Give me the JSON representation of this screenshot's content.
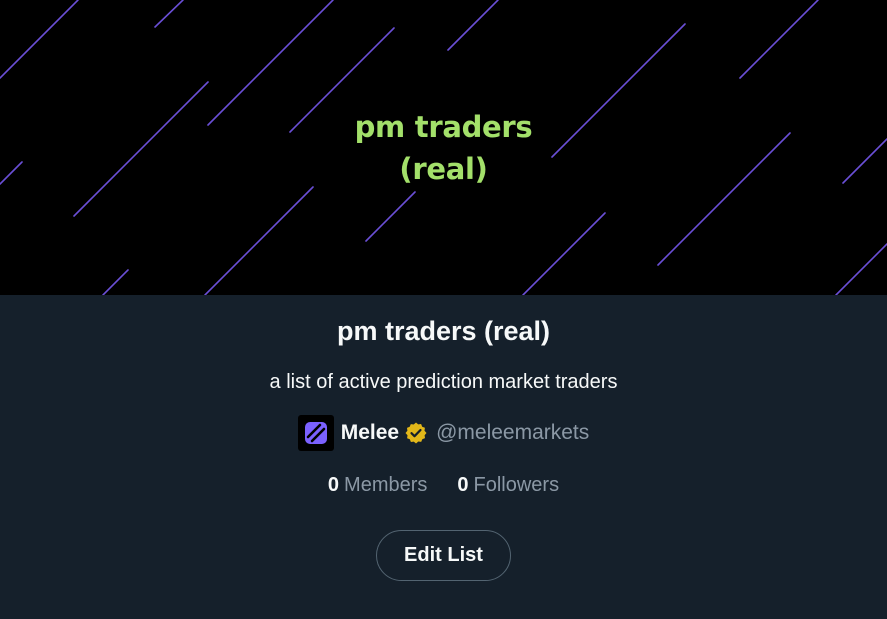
{
  "banner": {
    "title_line1": "pm traders",
    "title_line2": "(real)"
  },
  "list": {
    "name": "pm traders (real)",
    "description": "a list of active prediction market traders"
  },
  "owner": {
    "name": "Melee",
    "handle": "@meleemarkets",
    "avatar_icon": "melee-logo-icon",
    "badge_icon": "verified-badge-icon"
  },
  "stats": {
    "members_count": "0",
    "members_label": "Members",
    "followers_count": "0",
    "followers_label": "Followers"
  },
  "actions": {
    "edit_label": "Edit List"
  },
  "colors": {
    "background": "#15202b",
    "banner_bg": "#000000",
    "banner_text": "#a3e06a",
    "stripe": "#6a4fd6",
    "verified_gold": "#e2b719",
    "muted_text": "#8b98a5"
  }
}
